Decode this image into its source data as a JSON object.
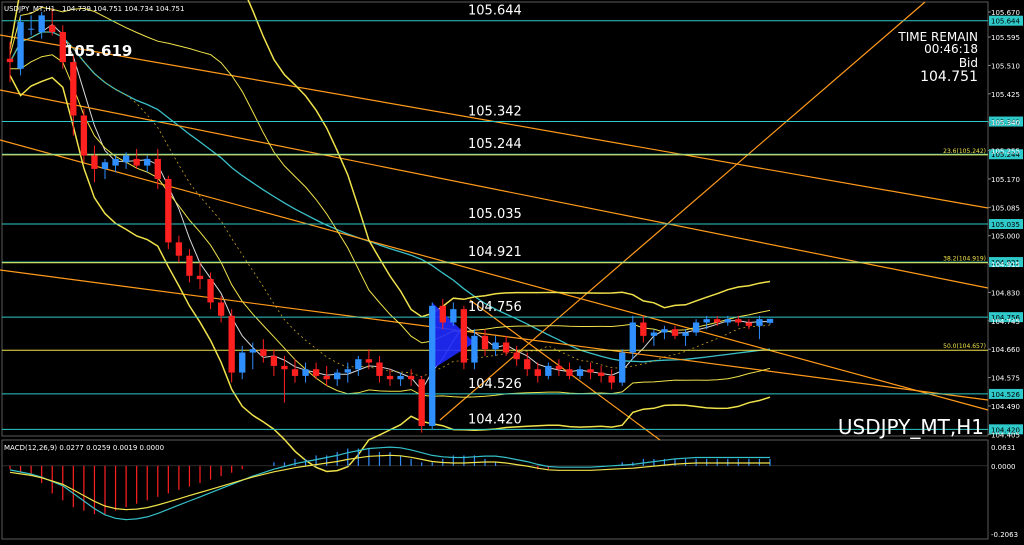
{
  "header": {
    "title": "USDJPY_MT,H1",
    "ohlc": "104.739 104.751 104.734 104.751"
  },
  "timer": {
    "label": "TIME REMAIN",
    "countdown": "00:46:18",
    "price_type": "Bid",
    "price": "104.751"
  },
  "watermark": "USDJPY_MT,H1",
  "macd_label": "MACD(12,26,9) 0.0277 0.0259 0.0019 0.0000",
  "colors": {
    "background": "#000000",
    "bull": "#2f8fff",
    "bear": "#ff2020",
    "level_line": "#2fc9c9",
    "bollinger": "#f0e24a",
    "trend": "#ff9a1a",
    "ma": "#3ac0c8",
    "axis_text": "#ffffff",
    "macd_signal": "#35c0c8",
    "macd_main": "#f0e24a",
    "fib": "#f0e24a",
    "triangle": "#1e2aff"
  },
  "chart_data": {
    "type": "candlestick",
    "title": "USDJPY_MT,H1",
    "ylim": [
      104.4,
      105.7
    ],
    "y_ticks": [
      "105.670",
      "105.595",
      "105.510",
      "105.425",
      "105.340",
      "105.255",
      "105.170",
      "105.085",
      "105.000",
      "104.915",
      "104.830",
      "104.745",
      "104.660",
      "104.575",
      "104.490",
      "104.405"
    ],
    "level_lines": [
      {
        "value": 105.644,
        "label": "105.644"
      },
      {
        "value": 105.342,
        "label": "105.342"
      },
      {
        "value": 105.244,
        "label": "105.244"
      },
      {
        "value": 105.035,
        "label": "105.035"
      },
      {
        "value": 104.921,
        "label": "104.921"
      },
      {
        "value": 104.756,
        "label": "104.756"
      },
      {
        "value": 104.526,
        "label": "104.526"
      },
      {
        "value": 104.42,
        "label": "104.420"
      }
    ],
    "fib_levels": [
      {
        "label": "23.6(105.242)",
        "value": 105.242
      },
      {
        "label": "38.2(104.919)",
        "value": 104.919
      },
      {
        "label": "50.0(104.657)",
        "value": 104.657
      }
    ],
    "high_label": "105.619",
    "current_price": "104.751",
    "candles": [
      {
        "o": 105.53,
        "h": 105.58,
        "l": 105.46,
        "c": 105.52
      },
      {
        "o": 105.5,
        "h": 105.66,
        "l": 105.48,
        "c": 105.64
      },
      {
        "o": 105.62,
        "h": 105.66,
        "l": 105.6,
        "c": 105.62
      },
      {
        "o": 105.61,
        "h": 105.67,
        "l": 105.59,
        "c": 105.66
      },
      {
        "o": 105.63,
        "h": 105.68,
        "l": 105.6,
        "c": 105.61
      },
      {
        "o": 105.61,
        "h": 105.63,
        "l": 105.5,
        "c": 105.52
      },
      {
        "o": 105.52,
        "h": 105.54,
        "l": 105.3,
        "c": 105.36
      },
      {
        "o": 105.36,
        "h": 105.38,
        "l": 105.22,
        "c": 105.24
      },
      {
        "o": 105.24,
        "h": 105.27,
        "l": 105.16,
        "c": 105.2
      },
      {
        "o": 105.2,
        "h": 105.23,
        "l": 105.17,
        "c": 105.22
      },
      {
        "o": 105.21,
        "h": 105.24,
        "l": 105.19,
        "c": 105.23
      },
      {
        "o": 105.22,
        "h": 105.25,
        "l": 105.2,
        "c": 105.24
      },
      {
        "o": 105.23,
        "h": 105.26,
        "l": 105.2,
        "c": 105.21
      },
      {
        "o": 105.21,
        "h": 105.24,
        "l": 105.19,
        "c": 105.23
      },
      {
        "o": 105.23,
        "h": 105.26,
        "l": 105.14,
        "c": 105.17
      },
      {
        "o": 105.17,
        "h": 105.18,
        "l": 104.96,
        "c": 104.98
      },
      {
        "o": 104.98,
        "h": 105.0,
        "l": 104.92,
        "c": 104.94
      },
      {
        "o": 104.94,
        "h": 104.96,
        "l": 104.86,
        "c": 104.88
      },
      {
        "o": 104.88,
        "h": 104.92,
        "l": 104.84,
        "c": 104.87
      },
      {
        "o": 104.87,
        "h": 104.89,
        "l": 104.78,
        "c": 104.8
      },
      {
        "o": 104.8,
        "h": 104.82,
        "l": 104.74,
        "c": 104.76
      },
      {
        "o": 104.76,
        "h": 104.78,
        "l": 104.56,
        "c": 104.59
      },
      {
        "o": 104.59,
        "h": 104.67,
        "l": 104.57,
        "c": 104.65
      },
      {
        "o": 104.65,
        "h": 104.68,
        "l": 104.6,
        "c": 104.66
      },
      {
        "o": 104.66,
        "h": 104.69,
        "l": 104.62,
        "c": 104.64
      },
      {
        "o": 104.64,
        "h": 104.66,
        "l": 104.58,
        "c": 104.61
      },
      {
        "o": 104.61,
        "h": 104.64,
        "l": 104.5,
        "c": 104.6
      },
      {
        "o": 104.6,
        "h": 104.63,
        "l": 104.56,
        "c": 104.58
      },
      {
        "o": 104.58,
        "h": 104.62,
        "l": 104.56,
        "c": 104.6
      },
      {
        "o": 104.6,
        "h": 104.62,
        "l": 104.57,
        "c": 104.58
      },
      {
        "o": 104.58,
        "h": 104.61,
        "l": 104.55,
        "c": 104.57
      },
      {
        "o": 104.57,
        "h": 104.6,
        "l": 104.55,
        "c": 104.59
      },
      {
        "o": 104.59,
        "h": 104.62,
        "l": 104.56,
        "c": 104.6
      },
      {
        "o": 104.6,
        "h": 104.64,
        "l": 104.58,
        "c": 104.63
      },
      {
        "o": 104.63,
        "h": 104.66,
        "l": 104.6,
        "c": 104.62
      },
      {
        "o": 104.62,
        "h": 104.64,
        "l": 104.56,
        "c": 104.58
      },
      {
        "o": 104.58,
        "h": 104.6,
        "l": 104.55,
        "c": 104.57
      },
      {
        "o": 104.57,
        "h": 104.59,
        "l": 104.55,
        "c": 104.58
      },
      {
        "o": 104.58,
        "h": 104.6,
        "l": 104.55,
        "c": 104.57
      },
      {
        "o": 104.57,
        "h": 104.58,
        "l": 104.41,
        "c": 104.43
      },
      {
        "o": 104.43,
        "h": 104.8,
        "l": 104.42,
        "c": 104.79
      },
      {
        "o": 104.79,
        "h": 104.81,
        "l": 104.72,
        "c": 104.74
      },
      {
        "o": 104.74,
        "h": 104.8,
        "l": 104.73,
        "c": 104.78
      },
      {
        "o": 104.78,
        "h": 104.79,
        "l": 104.6,
        "c": 104.62
      },
      {
        "o": 104.62,
        "h": 104.72,
        "l": 104.6,
        "c": 104.7
      },
      {
        "o": 104.7,
        "h": 104.72,
        "l": 104.64,
        "c": 104.66
      },
      {
        "o": 104.66,
        "h": 104.7,
        "l": 104.64,
        "c": 104.68
      },
      {
        "o": 104.68,
        "h": 104.7,
        "l": 104.64,
        "c": 104.65
      },
      {
        "o": 104.65,
        "h": 104.67,
        "l": 104.61,
        "c": 104.63
      },
      {
        "o": 104.63,
        "h": 104.65,
        "l": 104.58,
        "c": 104.6
      },
      {
        "o": 104.6,
        "h": 104.62,
        "l": 104.56,
        "c": 104.58
      },
      {
        "o": 104.58,
        "h": 104.62,
        "l": 104.57,
        "c": 104.61
      },
      {
        "o": 104.61,
        "h": 104.63,
        "l": 104.58,
        "c": 104.6
      },
      {
        "o": 104.6,
        "h": 104.62,
        "l": 104.57,
        "c": 104.58
      },
      {
        "o": 104.58,
        "h": 104.61,
        "l": 104.57,
        "c": 104.6
      },
      {
        "o": 104.6,
        "h": 104.62,
        "l": 104.57,
        "c": 104.59
      },
      {
        "o": 104.59,
        "h": 104.61,
        "l": 104.56,
        "c": 104.58
      },
      {
        "o": 104.58,
        "h": 104.6,
        "l": 104.54,
        "c": 104.56
      },
      {
        "o": 104.56,
        "h": 104.66,
        "l": 104.55,
        "c": 104.65
      },
      {
        "o": 104.65,
        "h": 104.76,
        "l": 104.63,
        "c": 104.74
      },
      {
        "o": 104.74,
        "h": 104.76,
        "l": 104.68,
        "c": 104.7
      },
      {
        "o": 104.7,
        "h": 104.72,
        "l": 104.67,
        "c": 104.71
      },
      {
        "o": 104.71,
        "h": 104.73,
        "l": 104.69,
        "c": 104.72
      },
      {
        "o": 104.72,
        "h": 104.73,
        "l": 104.69,
        "c": 104.7
      },
      {
        "o": 104.7,
        "h": 104.72,
        "l": 104.67,
        "c": 104.71
      },
      {
        "o": 104.71,
        "h": 104.75,
        "l": 104.7,
        "c": 104.74
      },
      {
        "o": 104.74,
        "h": 104.76,
        "l": 104.72,
        "c": 104.75
      },
      {
        "o": 104.75,
        "h": 104.76,
        "l": 104.73,
        "c": 104.74
      },
      {
        "o": 104.74,
        "h": 104.76,
        "l": 104.73,
        "c": 104.75
      },
      {
        "o": 104.75,
        "h": 104.76,
        "l": 104.73,
        "c": 104.74
      },
      {
        "o": 104.74,
        "h": 104.75,
        "l": 104.72,
        "c": 104.73
      },
      {
        "o": 104.73,
        "h": 104.76,
        "l": 104.69,
        "c": 104.75
      },
      {
        "o": 104.739,
        "h": 104.751,
        "l": 104.734,
        "c": 104.751
      }
    ],
    "macd": {
      "ylim": [
        -0.2063,
        0.0631
      ],
      "ticks": [
        "0.0631",
        "0.0000",
        "-0.2063"
      ],
      "histogram": [
        -0.01,
        -0.02,
        -0.03,
        -0.05,
        -0.08,
        -0.1,
        -0.12,
        -0.13,
        -0.14,
        -0.14,
        -0.13,
        -0.12,
        -0.11,
        -0.1,
        -0.09,
        -0.08,
        -0.07,
        -0.06,
        -0.05,
        -0.04,
        -0.03,
        -0.02,
        -0.01,
        0.0,
        0.0,
        0.01,
        0.01,
        0.02,
        0.02,
        0.03,
        0.03,
        0.04,
        0.05,
        0.05,
        0.05,
        0.04,
        0.04,
        0.03,
        0.02,
        0.01,
        0.01,
        0.02,
        0.03,
        0.03,
        0.03,
        0.02,
        0.01,
        0.0,
        0.0,
        0.0,
        -0.01,
        -0.01,
        0.0,
        0.0,
        0.0,
        0.0,
        0.0,
        0.0,
        0.01,
        0.01,
        0.02,
        0.02,
        0.02,
        0.02,
        0.02,
        0.02,
        0.02,
        0.02,
        0.02,
        0.02,
        0.02,
        0.02,
        0.02
      ]
    }
  }
}
